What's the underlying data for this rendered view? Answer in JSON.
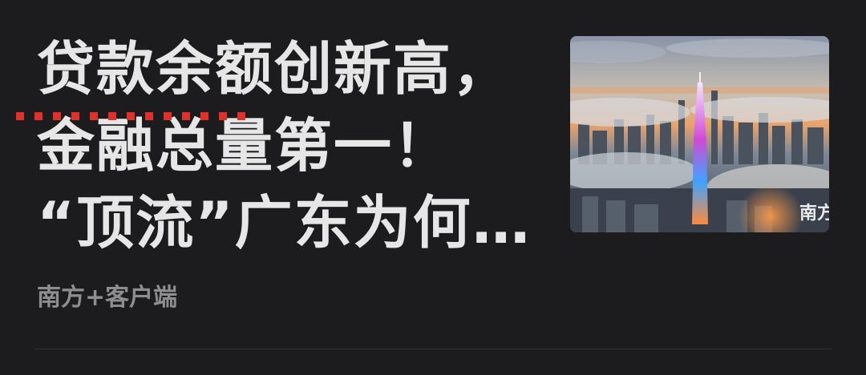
{
  "article": {
    "title_lines": [
      "贷款余额创新高，",
      "金融总量第一！",
      "“顶流”广东为何…"
    ],
    "source": "南方+客户端",
    "thumbnail_watermark": "南方",
    "thumbnail_subject": "guangzhou-skyline-canton-tower"
  },
  "colors": {
    "background": "#1c1c1e",
    "title": "#e6e6e6",
    "source": "#8e8e90",
    "spellcheck_underline": "#e0302a",
    "divider": "#2f2f32"
  }
}
